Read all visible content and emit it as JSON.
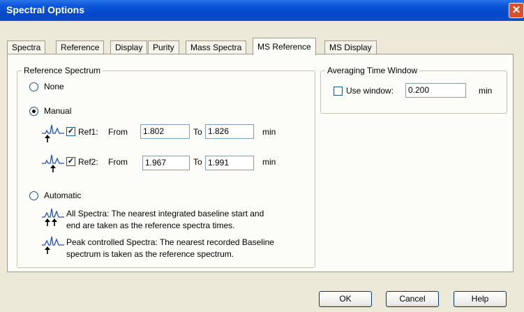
{
  "window": {
    "title": "Spectral Options",
    "close_glyph": "✕"
  },
  "tabs": [
    {
      "label": "Spectra"
    },
    {
      "label": "Reference"
    },
    {
      "label": "Display"
    },
    {
      "label": "Purity"
    },
    {
      "label": "Mass Spectra"
    },
    {
      "label": "MS Reference",
      "active": true
    },
    {
      "label": "MS Display"
    }
  ],
  "reference_spectrum": {
    "group_label": "Reference Spectrum",
    "none_label": "None",
    "manual_label": "Manual",
    "automatic_label": "Automatic",
    "selected": "Manual",
    "ref1": {
      "checked": true,
      "label": "Ref1:",
      "from_label": "From",
      "from_value": "1.802",
      "to_label": "To",
      "to_value": "1.826",
      "unit": "min",
      "icon": "peak-single-marker-icon"
    },
    "ref2": {
      "checked": true,
      "label": "Ref2:",
      "from_label": "From",
      "from_value": "1.967",
      "to_label": "To",
      "to_value": "1.991",
      "unit": "min",
      "icon": "peak-single-marker-icon"
    },
    "all_spectra_line1": "All Spectra: The nearest integrated baseline start and",
    "all_spectra_line2": "end are taken as the reference spectra times.",
    "peak_controlled_line1": "Peak controlled Spectra: The nearest recorded Baseline",
    "peak_controlled_line2": "spectrum is taken as the reference spectrum."
  },
  "averaging": {
    "group_label": "Averaging Time Window",
    "use_window_label": "Use window:",
    "use_window_checked": false,
    "value": "0.200",
    "unit": "min"
  },
  "buttons": {
    "ok": "OK",
    "cancel": "Cancel",
    "help": "Help"
  },
  "colors": {
    "titlebar": "#0a55d8",
    "dialog_bg": "#ece9d8",
    "panel_bg": "#fcfcf9",
    "peak_icon": "#1e50c8"
  }
}
